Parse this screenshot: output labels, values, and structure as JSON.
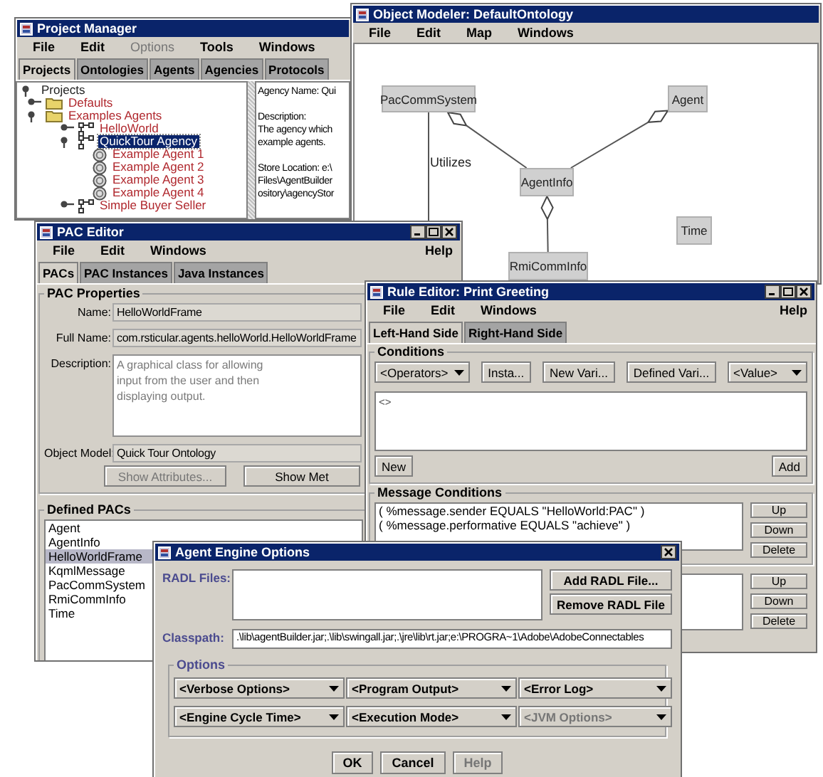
{
  "project_manager": {
    "title": "Project Manager",
    "menu": [
      {
        "label": "File",
        "disabled": false
      },
      {
        "label": "Edit",
        "disabled": false
      },
      {
        "label": "Options",
        "disabled": true
      },
      {
        "label": "Tools",
        "disabled": false
      },
      {
        "label": "Windows",
        "disabled": false
      }
    ],
    "tabs": [
      {
        "label": "Projects",
        "selected": true
      },
      {
        "label": "Ontologies",
        "selected": false
      },
      {
        "label": "Agents",
        "selected": false
      },
      {
        "label": "Agencies",
        "selected": false
      },
      {
        "label": "Protocols",
        "selected": false
      }
    ],
    "tree": [
      {
        "label": "Projects",
        "kind": "root",
        "expanded": true,
        "selected": false,
        "children": [
          {
            "label": "Defaults",
            "kind": "folder",
            "expanded": false,
            "selected": false
          },
          {
            "label": "Examples Agents",
            "kind": "folder",
            "expanded": true,
            "selected": false,
            "children": [
              {
                "label": "HelloWorld",
                "kind": "agency",
                "expanded": false,
                "selected": false
              },
              {
                "label": "QuickTour Agency",
                "kind": "agency",
                "expanded": true,
                "selected": true,
                "children": [
                  {
                    "label": "Example Agent 1",
                    "kind": "agent",
                    "selected": false
                  },
                  {
                    "label": "Example Agent 2",
                    "kind": "agent",
                    "selected": false
                  },
                  {
                    "label": "Example Agent 3",
                    "kind": "agent",
                    "selected": false
                  },
                  {
                    "label": "Example Agent 4",
                    "kind": "agent",
                    "selected": false
                  }
                ]
              },
              {
                "label": "Simple Buyer Seller",
                "kind": "agency",
                "expanded": false,
                "selected": false
              }
            ]
          }
        ]
      }
    ],
    "details": [
      [
        "Agency Name: Qui"
      ],
      [
        "Description:",
        "The agency which",
        "example agents."
      ],
      [
        "Store Location: e:\\",
        "Files\\AgentBuilder",
        "ository\\agencyStor"
      ]
    ]
  },
  "object_modeler": {
    "title": "Object Modeler: DefaultOntology",
    "menu": [
      "File",
      "Edit",
      "Map",
      "Windows"
    ],
    "nodes": [
      {
        "label": "PacCommSystem"
      },
      {
        "label": "Agent"
      },
      {
        "label": "AgentInfo"
      },
      {
        "label": "RmiCommInfo"
      },
      {
        "label": "Time"
      }
    ],
    "edges": [
      {
        "kind": "association",
        "label": "Utilizes"
      },
      {
        "kind": "aggregation"
      },
      {
        "kind": "aggregation"
      },
      {
        "kind": "aggregation"
      }
    ]
  },
  "pac_editor": {
    "title": "PAC Editor",
    "menu": [
      "File",
      "Edit",
      "Windows"
    ],
    "help_menu": "Help",
    "tabs": [
      {
        "label": "PACs",
        "selected": true
      },
      {
        "label": "PAC Instances",
        "selected": false
      },
      {
        "label": "Java Instances",
        "selected": false
      }
    ],
    "properties": {
      "title": "PAC Properties",
      "fields": [
        {
          "label": "Name:",
          "kind": "field",
          "value": "HelloWorldFrame"
        },
        {
          "label": "Full Name:",
          "kind": "field",
          "value": "com.rsticular.agents.helloWorld.HelloWorldFrame"
        },
        {
          "label": "Description:",
          "kind": "textarea",
          "disabled": true,
          "value": "A graphical class for allowing\ninput from the user and then\ndisplaying output."
        },
        {
          "label": "Object Model:",
          "kind": "field",
          "value": "Quick Tour Ontology"
        }
      ],
      "buttons": [
        {
          "label": "Show Attributes...",
          "disabled": true
        },
        {
          "label": "Show Met",
          "disabled": false
        }
      ]
    },
    "defined_pacs": {
      "title": "Defined PACs",
      "items": [
        {
          "label": "Agent",
          "selected": false
        },
        {
          "label": "AgentInfo",
          "selected": false
        },
        {
          "label": "HelloWorldFrame",
          "selected": true
        },
        {
          "label": "KqmlMessage",
          "selected": false
        },
        {
          "label": "PacCommSystem",
          "selected": false
        },
        {
          "label": "RmiCommInfo",
          "selected": false
        },
        {
          "label": "Time",
          "selected": false
        }
      ]
    }
  },
  "rule_editor": {
    "title": "Rule Editor: Print Greeting",
    "menu": [
      "File",
      "Edit",
      "Windows"
    ],
    "help_menu": "Help",
    "tabs": [
      {
        "label": "Left-Hand Side",
        "selected": true
      },
      {
        "label": "Right-Hand Side",
        "selected": false
      }
    ],
    "conditions": {
      "title": "Conditions",
      "controls": [
        {
          "kind": "dropdown",
          "label": "<Operators>"
        },
        {
          "kind": "button",
          "label": "Insta..."
        },
        {
          "kind": "button",
          "label": "New Vari..."
        },
        {
          "kind": "button",
          "label": "Defined Vari..."
        },
        {
          "kind": "dropdown",
          "label": "<Value>"
        }
      ],
      "editor_text": "<>",
      "buttons": [
        "New",
        "Add"
      ]
    },
    "message_conditions": {
      "title": "Message Conditions",
      "items": [
        "( %message.sender EQUALS  \"HelloWorld:PAC\"  )",
        "( %message.performative EQUALS  \"achieve\"  )"
      ],
      "buttons": [
        "Up",
        "Down",
        "Delete"
      ]
    },
    "lower_list": {
      "buttons": [
        "Up",
        "Down",
        "Delete"
      ]
    }
  },
  "agent_engine_options": {
    "title": "Agent Engine Options",
    "radl_label": "RADL Files:",
    "radl_buttons": [
      "Add RADL File...",
      "Remove RADL File"
    ],
    "classpath_label": "Classpath:",
    "classpath": ".\\lib\\agentBuilder.jar;.\\lib\\swingall.jar;.\\jre\\lib\\rt.jar;e:\\PROGRA~1\\Adobe\\AdobeConnectables",
    "options": {
      "title": "Options",
      "dropdowns": [
        {
          "label": "<Verbose Options>",
          "disabled": false
        },
        {
          "label": "<Program Output>",
          "disabled": false
        },
        {
          "label": "<Error Log>",
          "disabled": false
        },
        {
          "label": "<Engine Cycle Time>",
          "disabled": false
        },
        {
          "label": "<Execution Mode>",
          "disabled": false
        },
        {
          "label": "<JVM Options>",
          "disabled": true
        }
      ]
    },
    "buttons": [
      {
        "label": "OK",
        "disabled": false
      },
      {
        "label": "Cancel",
        "disabled": false
      },
      {
        "label": "Help",
        "disabled": true
      }
    ]
  }
}
